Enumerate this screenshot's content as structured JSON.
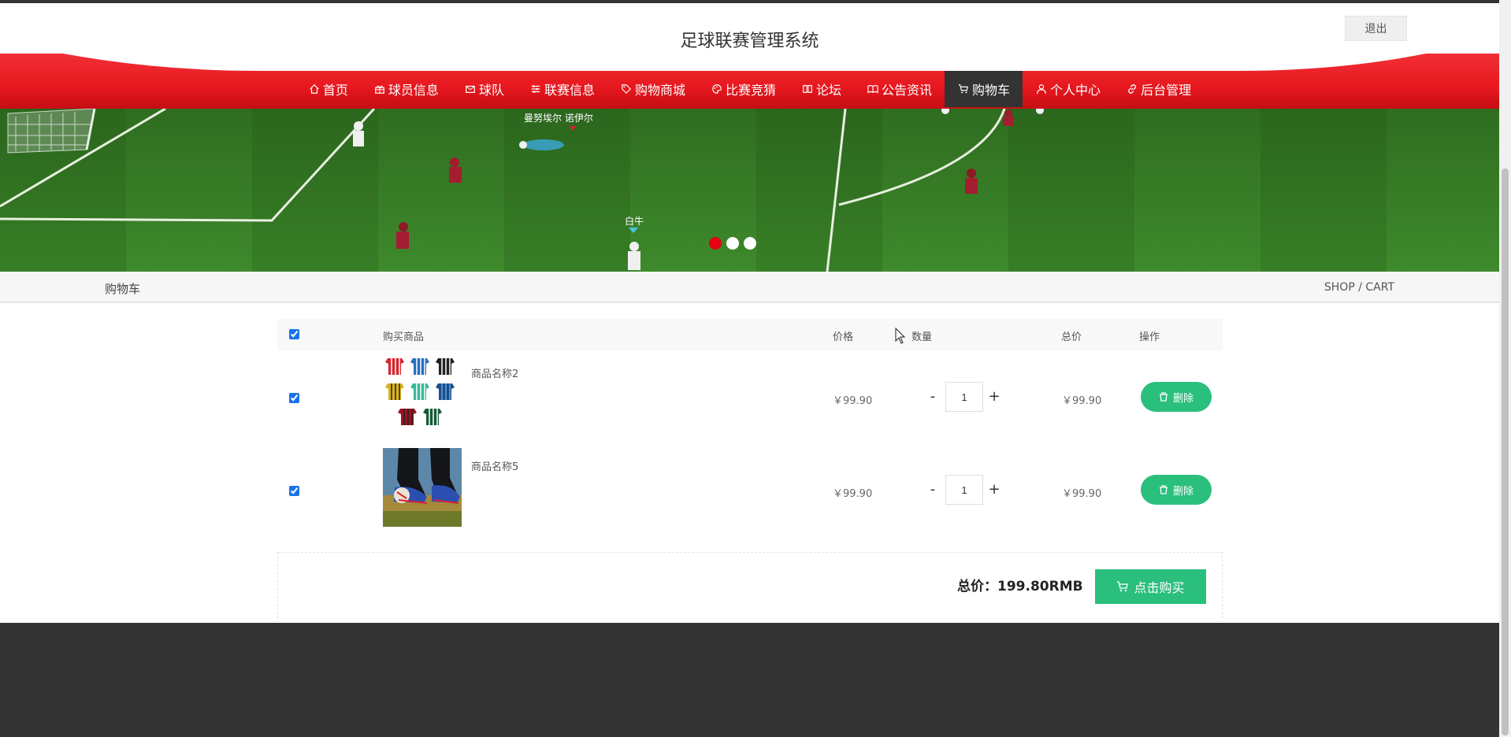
{
  "header": {
    "title": "足球联赛管理系统",
    "logout_label": "退出"
  },
  "nav": {
    "items": [
      {
        "label": "首页",
        "icon": "home-icon"
      },
      {
        "label": "球员信息",
        "icon": "gift-icon"
      },
      {
        "label": "球队",
        "icon": "mail-icon"
      },
      {
        "label": "联赛信息",
        "icon": "sliders-icon"
      },
      {
        "label": "购物商城",
        "icon": "tag-icon"
      },
      {
        "label": "比赛竞猜",
        "icon": "palette-icon"
      },
      {
        "label": "论坛",
        "icon": "book-icon"
      },
      {
        "label": "公告资讯",
        "icon": "news-icon"
      },
      {
        "label": "购物车",
        "icon": "cart-icon",
        "active": true
      },
      {
        "label": "个人中心",
        "icon": "user-icon"
      },
      {
        "label": "后台管理",
        "icon": "link-icon"
      }
    ],
    "color": "#e8181f",
    "active_color": "#333333"
  },
  "banner": {
    "slide_count": 3,
    "active_index": 0,
    "overlay_labels": [
      "曼努埃尔 诺伊尔",
      "白牛"
    ]
  },
  "breadcrumb": {
    "title": "购物车",
    "path": "SHOP / CART"
  },
  "cart": {
    "columns": {
      "product": "购买商品",
      "price": "价格",
      "quantity": "数量",
      "total": "总价",
      "action": "操作"
    },
    "select_all": true,
    "rows": [
      {
        "name": "商品名称2",
        "price": "￥99.90",
        "quantity": "1",
        "total": "￥99.90",
        "delete_label": "删除",
        "checked": true,
        "minus": "-",
        "plus": "+"
      },
      {
        "name": "商品名称5",
        "price": "￥99.90",
        "quantity": "1",
        "total": "￥99.90",
        "delete_label": "删除",
        "checked": true,
        "minus": "-",
        "plus": "+"
      }
    ],
    "summary_label": "总价：199.80RMB",
    "buy_label": "点击购买",
    "button_color": "#2bbf7e"
  }
}
